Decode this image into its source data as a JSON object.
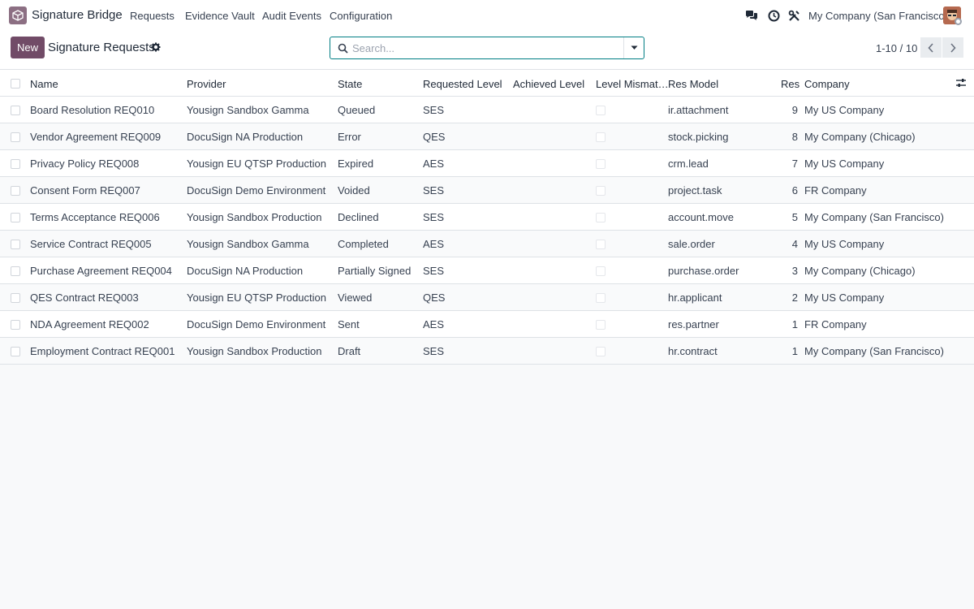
{
  "app": {
    "name": "Signature Bridge",
    "brand_color": "#714b67",
    "accent_color": "#017e84"
  },
  "menu": [
    "Requests",
    "Evidence Vault",
    "Audit Events",
    "Configuration"
  ],
  "systray": {
    "icons": [
      "chat-icon",
      "clock-icon",
      "tools-icon"
    ],
    "company": "My Company (San Francisco)"
  },
  "control": {
    "new_label": "New",
    "title": "Signature Requests",
    "search_placeholder": "Search...",
    "pager": "1-10 / 10"
  },
  "table": {
    "columns": [
      "Name",
      "Provider",
      "State",
      "Requested Level",
      "Achieved Level",
      "Level Mismat…",
      "Res Model",
      "Res",
      "Company"
    ],
    "rows": [
      {
        "name": "Board Resolution REQ010",
        "provider": "Yousign Sandbox Gamma",
        "state": "Queued",
        "requested": "SES",
        "achieved": "",
        "mismatch": false,
        "model": "ir.attachment",
        "res": "9",
        "company": "My US Company"
      },
      {
        "name": "Vendor Agreement REQ009",
        "provider": "DocuSign NA Production",
        "state": "Error",
        "requested": "QES",
        "achieved": "",
        "mismatch": false,
        "model": "stock.picking",
        "res": "8",
        "company": "My Company (Chicago)"
      },
      {
        "name": "Privacy Policy REQ008",
        "provider": "Yousign EU QTSP Production",
        "state": "Expired",
        "requested": "AES",
        "achieved": "",
        "mismatch": false,
        "model": "crm.lead",
        "res": "7",
        "company": "My US Company"
      },
      {
        "name": "Consent Form REQ007",
        "provider": "DocuSign Demo Environment",
        "state": "Voided",
        "requested": "SES",
        "achieved": "",
        "mismatch": false,
        "model": "project.task",
        "res": "6",
        "company": "FR Company"
      },
      {
        "name": "Terms Acceptance REQ006",
        "provider": "Yousign Sandbox Production",
        "state": "Declined",
        "requested": "SES",
        "achieved": "",
        "mismatch": false,
        "model": "account.move",
        "res": "5",
        "company": "My Company (San Francisco)"
      },
      {
        "name": "Service Contract REQ005",
        "provider": "Yousign Sandbox Gamma",
        "state": "Completed",
        "requested": "AES",
        "achieved": "",
        "mismatch": false,
        "model": "sale.order",
        "res": "4",
        "company": "My US Company"
      },
      {
        "name": "Purchase Agreement REQ004",
        "provider": "DocuSign NA Production",
        "state": "Partially Signed",
        "requested": "SES",
        "achieved": "",
        "mismatch": false,
        "model": "purchase.order",
        "res": "3",
        "company": "My Company (Chicago)"
      },
      {
        "name": "QES Contract REQ003",
        "provider": "Yousign EU QTSP Production",
        "state": "Viewed",
        "requested": "QES",
        "achieved": "",
        "mismatch": false,
        "model": "hr.applicant",
        "res": "2",
        "company": "My US Company"
      },
      {
        "name": "NDA Agreement REQ002",
        "provider": "DocuSign Demo Environment",
        "state": "Sent",
        "requested": "AES",
        "achieved": "",
        "mismatch": false,
        "model": "res.partner",
        "res": "1",
        "company": "FR Company"
      },
      {
        "name": "Employment Contract REQ001",
        "provider": "Yousign Sandbox Production",
        "state": "Draft",
        "requested": "SES",
        "achieved": "",
        "mismatch": false,
        "model": "hr.contract",
        "res": "1",
        "company": "My Company (San Francisco)"
      }
    ]
  }
}
